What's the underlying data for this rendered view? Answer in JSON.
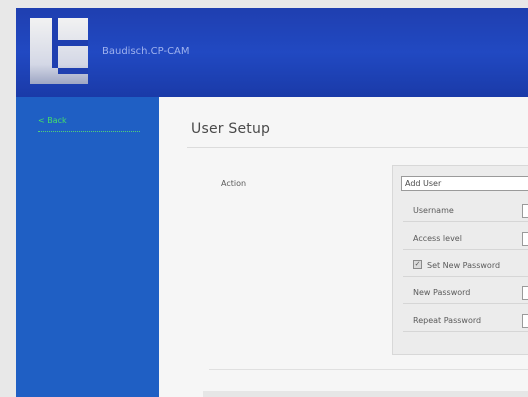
{
  "app": {
    "brand": "Baudisch.CP-CAM"
  },
  "sidebar": {
    "back_label": "< Back"
  },
  "main": {
    "title": "User Setup",
    "action_label": "Action",
    "action_select_value": "Add User",
    "fields": [
      {
        "label": "Username"
      },
      {
        "label": "Access level"
      },
      {
        "label": "Set New Password",
        "type": "checkbox",
        "checked": true
      },
      {
        "label": "New Password"
      },
      {
        "label": "Repeat Password"
      }
    ]
  },
  "colors": {
    "header": "#2149c2",
    "sidebar": "#1f5fc4",
    "back_link": "#44e06a"
  }
}
